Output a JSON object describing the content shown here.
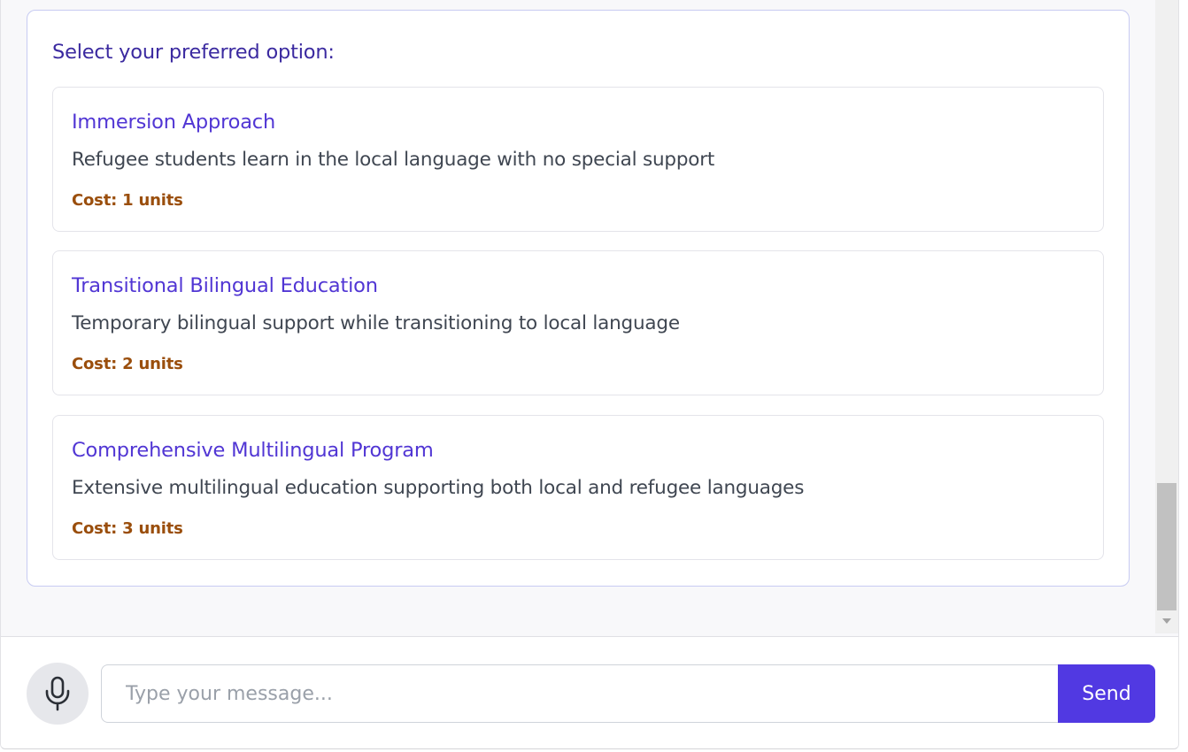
{
  "options_panel": {
    "title": "Select your preferred option:",
    "options": [
      {
        "title": "Immersion Approach",
        "description": "Refugee students learn in the local language with no special support",
        "cost": "Cost: 1 units"
      },
      {
        "title": "Transitional Bilingual Education",
        "description": "Temporary bilingual support while transitioning to local language",
        "cost": "Cost: 2 units"
      },
      {
        "title": "Comprehensive Multilingual Program",
        "description": "Extensive multilingual education supporting both local and refugee languages",
        "cost": "Cost: 3 units"
      }
    ]
  },
  "input_bar": {
    "mic_icon": "microphone-icon",
    "placeholder": "Type your message...",
    "value": "",
    "send_label": "Send"
  },
  "colors": {
    "accent": "#5139e2",
    "option_title": "#5136d4",
    "cost": "#9a4e0c",
    "panel_border": "#c7cbf2"
  }
}
